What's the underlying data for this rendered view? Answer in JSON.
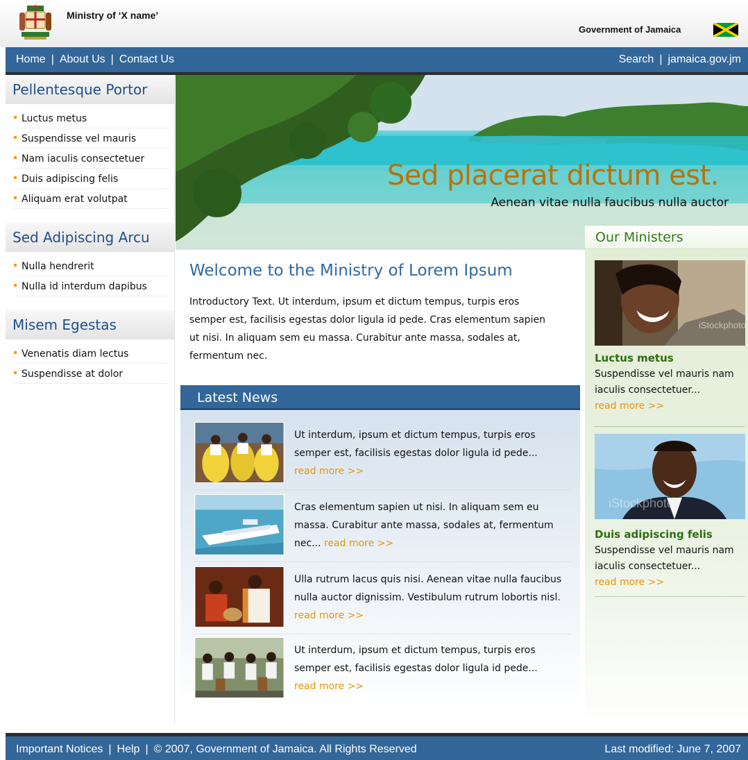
{
  "header": {
    "ministry_name": "Ministry of ‘X name’",
    "government_name": "Government of Jamaica",
    "crest_icon": "coat-of-arms-icon",
    "flag_icon": "jamaica-flag-icon",
    "flag_colors": {
      "green": "#009b3a",
      "gold": "#fed100",
      "black": "#000000"
    }
  },
  "topnav": {
    "home": "Home",
    "about": "About Us",
    "contact": "Contact Us",
    "search": "Search",
    "site": "jamaica.gov.jm",
    "separator": "|"
  },
  "sidebar": {
    "sections": [
      {
        "title": "Pellentesque Portor",
        "items": [
          "Luctus metus",
          "Suspendisse vel mauris",
          "Nam iaculis consectetuer",
          "Duis adipiscing felis",
          "Aliquam erat volutpat"
        ]
      },
      {
        "title": "Sed Adipiscing Arcu",
        "items": [
          "Nulla hendrerit",
          "Nulla id interdum dapibus"
        ]
      },
      {
        "title": "Misem Egestas",
        "items": [
          "Venenatis diam lectus",
          "Suspendisse at dolor"
        ]
      }
    ]
  },
  "hero": {
    "title": "Sed placerat dictum est.",
    "subtitle": "Aenean vitae nulla faucibus nulla auctor"
  },
  "welcome": {
    "title": "Welcome to the Ministry of Lorem Ipsum",
    "text": "Introductory Text. Ut interdum, ipsum et dictum tempus, turpis eros semper est, facilisis egestas dolor ligula id pede. Cras elementum sapien ut nisi. In aliquam sem eu massa. Curabitur ante massa, sodales at, fermentum nec."
  },
  "news": {
    "heading": "Latest News",
    "read_more": "read more >>",
    "items": [
      {
        "text": "Ut interdum, ipsum et dictum tempus, turpis eros semper est, facilisis egestas dolor ligula id pede...",
        "image": "dancers-photo"
      },
      {
        "text": "Cras elementum sapien ut nisi. In aliquam sem eu massa. Curabitur ante massa, sodales at, fermentum nec...",
        "image": "cruise-ship-photo"
      },
      {
        "text": "Ulla rutrum lacus quis nisi. Aenean vitae nulla faucibus nulla auctor dignissim. Vestibulum rutrum lobortis nisl.",
        "image": "drummers-photo"
      },
      {
        "text": "Ut interdum, ipsum et dictum tempus, turpis eros semper est, facilisis egestas dolor ligula id pede...",
        "image": "drum-band-photo"
      }
    ]
  },
  "ministers": {
    "heading": "Our Ministers",
    "read_more": "read more >>",
    "items": [
      {
        "name": "Luctus metus",
        "desc": "Suspendisse vel mauris nam iaculis consectetuer...",
        "watermark": "iStockphoto"
      },
      {
        "name": "Duis adipiscing felis",
        "desc": "Suspendisse vel mauris nam iaculis consectetuer...",
        "watermark": "iStockphoto"
      }
    ]
  },
  "footer": {
    "notices": "Important Notices",
    "help": "Help",
    "copyright": "©  2007, Government of Jamaica. All Rights Reserved",
    "last_modified": "Last modified: June 7, 2007",
    "separator": "|"
  },
  "colors": {
    "nav_blue": "#336699",
    "heading_blue": "#2f6aa1",
    "accent_orange": "#e8950a",
    "hero_title": "#b8720a",
    "minister_green": "#2e6e10"
  }
}
